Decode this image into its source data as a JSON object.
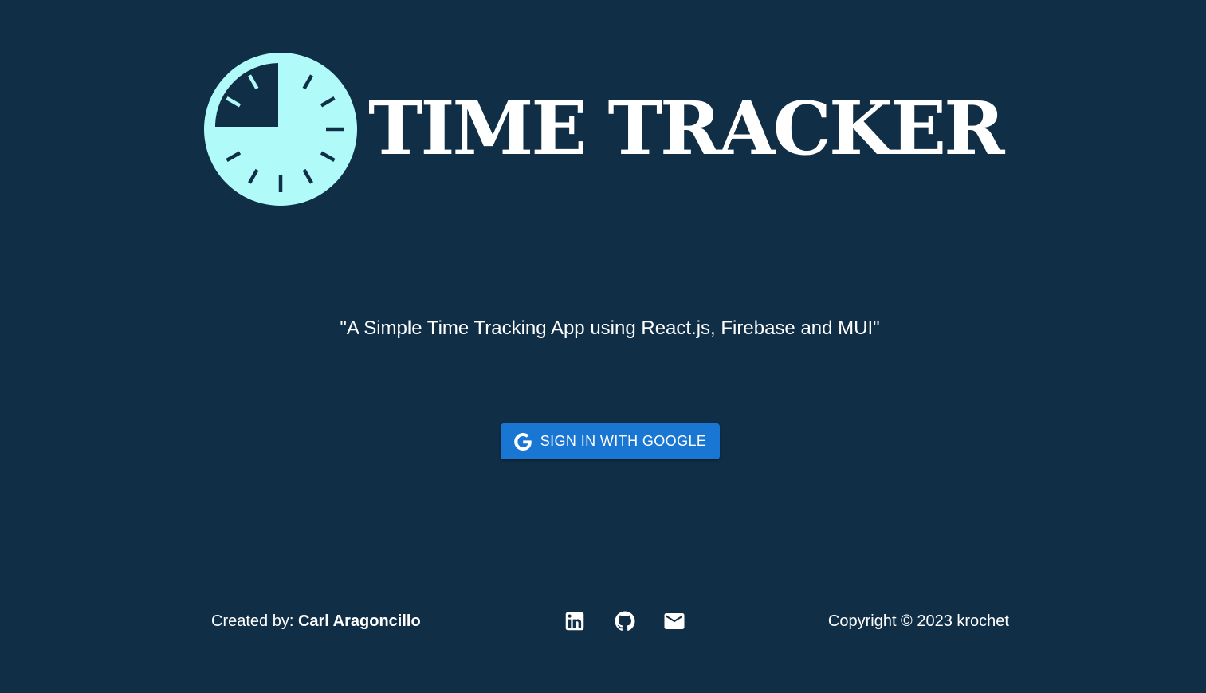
{
  "header": {
    "logo_icon": "clock-icon",
    "title": "TIME TRACKER"
  },
  "tagline": "\"A Simple Time Tracking App using React.js, Firebase and MUI\"",
  "signin": {
    "label": "SIGN IN WITH GOOGLE",
    "icon": "google-icon"
  },
  "footer": {
    "created_by_label": "Created by: ",
    "author": "Carl Aragoncillo",
    "links": [
      {
        "icon": "linkedin-icon"
      },
      {
        "icon": "github-icon"
      },
      {
        "icon": "email-icon"
      }
    ],
    "copyright": "Copyright © 2023 krochet"
  },
  "colors": {
    "background": "#102e46",
    "logo": "#b0fbf9",
    "button": "#1976d2",
    "text": "#ffffff"
  }
}
